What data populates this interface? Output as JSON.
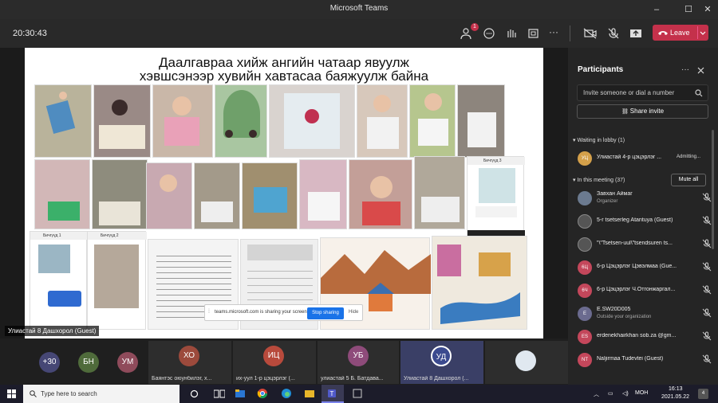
{
  "window": {
    "title": "Microsoft Teams",
    "minimize": "–",
    "maximize": "☐",
    "close": "✕"
  },
  "toolbar": {
    "time": "20:30:43",
    "participants_badge": "1",
    "leave_label": "Leave",
    "more": "···"
  },
  "slide": {
    "title_line1": "Даалгавраа хийж ангийн чатаар явуулж",
    "title_line2": "хэвшсэнээр хувийн хавтасаа баяжуулж байна",
    "chat1_header": "Бичгүүд 1",
    "chat2_header": "Бичгүүд 2",
    "chat3_header": "Бичгүүд 3"
  },
  "share_bar": {
    "text": "teams.microsoft.com is sharing your screen.",
    "stop_label": "Stop sharing",
    "hide_label": "Hide"
  },
  "presenter_label": "Улиастай 8 Дашхорол (Guest)",
  "gallery": [
    {
      "initials": "+30",
      "color": "#464775",
      "name": ""
    },
    {
      "initials": "БН",
      "color": "#4f6b3b",
      "name": ""
    },
    {
      "initials": "УМ",
      "color": "#8f4b5b",
      "name": ""
    },
    {
      "initials": "ХО",
      "color": "#9c4a3c",
      "name": "Баянтэс оюунбилэг, х..."
    },
    {
      "initials": "ИЦ",
      "color": "#b84a3c",
      "name": "их-уул 1-р цэцэрлэг (..."
    },
    {
      "initials": "УБ",
      "color": "#8e4b7a",
      "name": "улиастай 5 Б. Батдава..."
    },
    {
      "initials": "УД",
      "color": "#3b4a8f",
      "name": "Улиастай 8 Дашхорол (..."
    }
  ],
  "panel": {
    "title": "Participants",
    "search_placeholder": "Invite someone or dial a number",
    "share_invite": "Share invite",
    "lobby_header": "Waiting in lobby (1)",
    "lobby_person": {
      "initials": "УЦ",
      "name": "Улиастай 4-р цэцэрлэг ...",
      "status": "Admitting..."
    },
    "meeting_header": "In this meeting (37)",
    "mute_all": "Mute all",
    "people": [
      {
        "initials": "",
        "color": "#6b7a8f",
        "name": "Завхан Аймаг",
        "sub": "Organizer"
      },
      {
        "initials": "",
        "color": "#555",
        "name": "5-r tsetserleg Atantuya (Guest)",
        "sub": ""
      },
      {
        "initials": "",
        "color": "#555",
        "name": "\"\\\"Tsetsen-uul\\\"tsendsuren ts...",
        "sub": ""
      },
      {
        "initials": "6Ц",
        "color": "#c4475b",
        "name": "6-р Цэцэрлэг Цэвэлмаа (Gue...",
        "sub": ""
      },
      {
        "initials": "6Ч",
        "color": "#c4475b",
        "name": "6-р Цэцэрлэг Ч.Отгонжаргал...",
        "sub": ""
      },
      {
        "initials": "E",
        "color": "#6b6b8f",
        "name": "E.SW20D005",
        "sub": "Outside your organization"
      },
      {
        "initials": "ES",
        "color": "#c4475b",
        "name": "erdenekhairkhan sob.za @gm...",
        "sub": ""
      },
      {
        "initials": "NT",
        "color": "#c4475b",
        "name": "Naljirmaa Tudevtei (Guest)",
        "sub": ""
      }
    ]
  },
  "taskbar": {
    "search_placeholder": "Type here to search",
    "time": "16:13",
    "date": "2021.05.22",
    "lang": "MOH",
    "notif": "4"
  }
}
